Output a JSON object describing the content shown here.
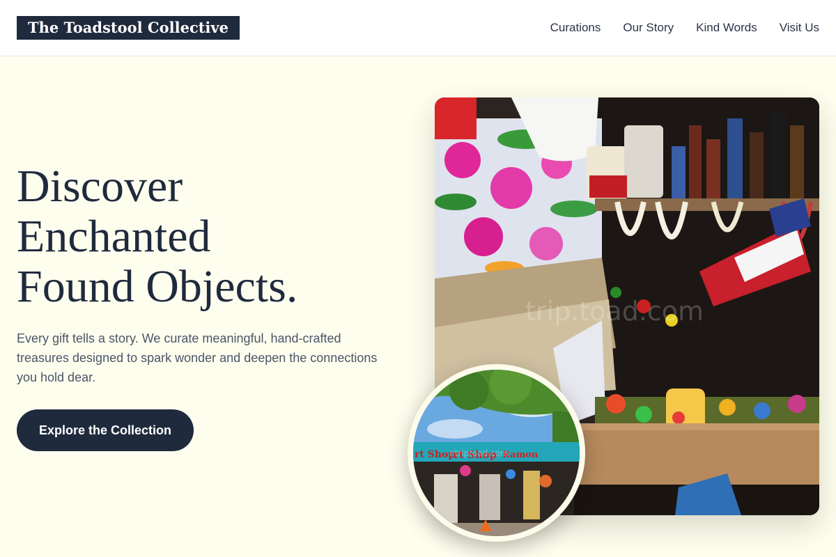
{
  "header": {
    "logo": "The Toadstool Collective",
    "nav": [
      {
        "label": "Curations"
      },
      {
        "label": "Our Story"
      },
      {
        "label": "Kind Words"
      },
      {
        "label": "Visit Us"
      }
    ]
  },
  "hero": {
    "headline_lines": [
      "Discover",
      "Enchanted",
      "Found Objects."
    ],
    "subtext": "Every gift tells a story. We curate meaningful, hand-crafted treasures designed to spark wonder and deepen the connections you hold dear.",
    "cta_label": "Explore the Collection"
  },
  "photos": {
    "main_watermark": "trip.toad.com",
    "inset_sign_left": "rt Shop",
    "inset_sign_mid": "rt Shop",
    "inset_sign_right": "Ramon",
    "inset_watermark": "ntriptoad.com"
  },
  "colors": {
    "background": "#fefeef",
    "navy": "#1f2a3d",
    "body_text": "#4b5565",
    "header_bg": "#ffffff"
  }
}
